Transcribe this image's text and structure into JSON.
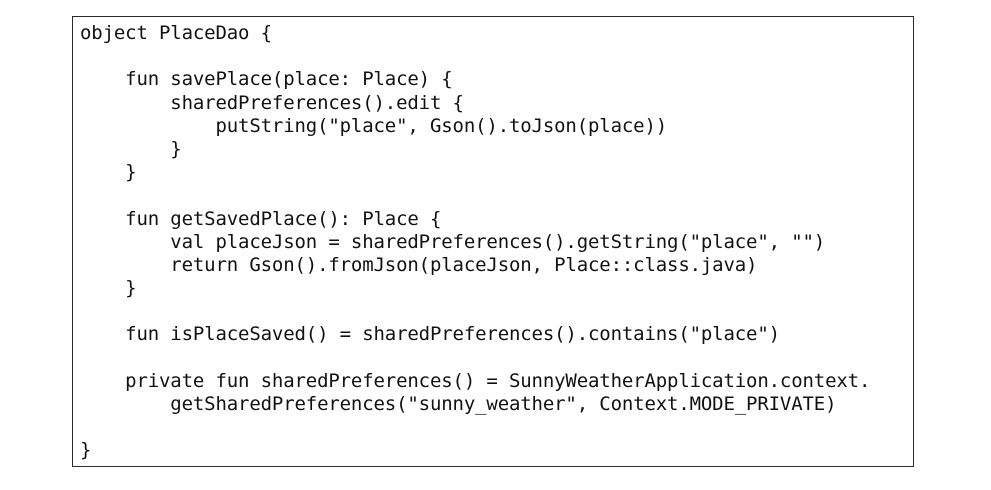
{
  "code": {
    "lines": [
      "object PlaceDao {",
      "",
      "    fun savePlace(place: Place) {",
      "        sharedPreferences().edit {",
      "            putString(\"place\", Gson().toJson(place))",
      "        }",
      "    }",
      "",
      "    fun getSavedPlace(): Place {",
      "        val placeJson = sharedPreferences().getString(\"place\", \"\")",
      "        return Gson().fromJson(placeJson, Place::class.java)",
      "    }",
      "",
      "    fun isPlaceSaved() = sharedPreferences().contains(\"place\")",
      "",
      "    private fun sharedPreferences() = SunnyWeatherApplication.context.",
      "        getSharedPreferences(\"sunny_weather\", Context.MODE_PRIVATE)",
      "",
      "}"
    ]
  }
}
